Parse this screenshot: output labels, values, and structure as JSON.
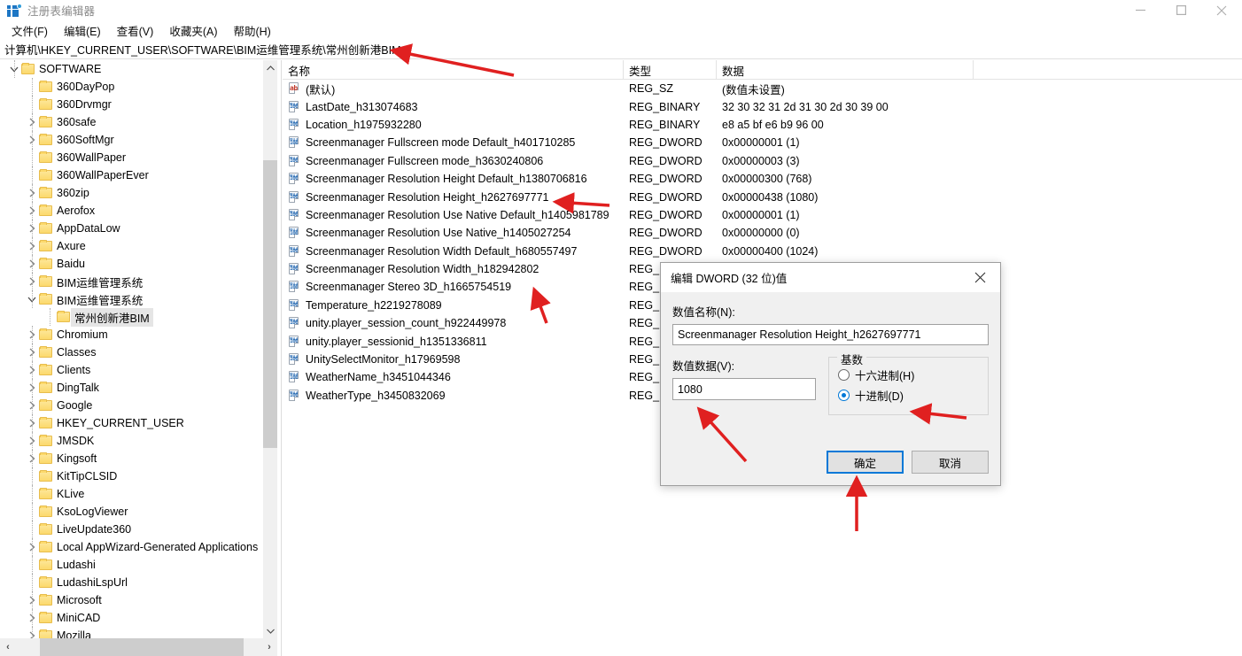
{
  "window": {
    "title": "注册表编辑器",
    "icon": "registry-editor-icon",
    "minimize": "–",
    "maximize": "□",
    "close": "✕"
  },
  "menu": [
    {
      "label": "文件(F)"
    },
    {
      "label": "编辑(E)"
    },
    {
      "label": "查看(V)"
    },
    {
      "label": "收藏夹(A)"
    },
    {
      "label": "帮助(H)"
    }
  ],
  "address": {
    "path": "计算机\\HKEY_CURRENT_USER\\SOFTWARE\\BIM运维管理系统\\常州创新港BIM"
  },
  "tree": {
    "items": [
      {
        "label": "SOFTWARE",
        "indent": 0,
        "expander": "open",
        "selected": false
      },
      {
        "label": "360DayPop",
        "indent": 1,
        "expander": "none",
        "selected": false
      },
      {
        "label": "360Drvmgr",
        "indent": 1,
        "expander": "none",
        "selected": false
      },
      {
        "label": "360safe",
        "indent": 1,
        "expander": "closed",
        "selected": false
      },
      {
        "label": "360SoftMgr",
        "indent": 1,
        "expander": "closed",
        "selected": false
      },
      {
        "label": "360WallPaper",
        "indent": 1,
        "expander": "none",
        "selected": false
      },
      {
        "label": "360WallPaperEver",
        "indent": 1,
        "expander": "none",
        "selected": false
      },
      {
        "label": "360zip",
        "indent": 1,
        "expander": "closed",
        "selected": false
      },
      {
        "label": "Aerofox",
        "indent": 1,
        "expander": "closed",
        "selected": false
      },
      {
        "label": "AppDataLow",
        "indent": 1,
        "expander": "closed",
        "selected": false
      },
      {
        "label": "Axure",
        "indent": 1,
        "expander": "closed",
        "selected": false
      },
      {
        "label": "Baidu",
        "indent": 1,
        "expander": "closed",
        "selected": false
      },
      {
        "label": "BIM运维管理系统",
        "indent": 1,
        "expander": "closed",
        "selected": false
      },
      {
        "label": "BIM运维管理系统",
        "indent": 1,
        "expander": "open",
        "selected": false
      },
      {
        "label": "常州创新港BIM",
        "indent": 2,
        "expander": "none",
        "selected": true
      },
      {
        "label": "Chromium",
        "indent": 1,
        "expander": "closed",
        "selected": false
      },
      {
        "label": "Classes",
        "indent": 1,
        "expander": "closed",
        "selected": false
      },
      {
        "label": "Clients",
        "indent": 1,
        "expander": "closed",
        "selected": false
      },
      {
        "label": "DingTalk",
        "indent": 1,
        "expander": "closed",
        "selected": false
      },
      {
        "label": "Google",
        "indent": 1,
        "expander": "closed",
        "selected": false
      },
      {
        "label": "HKEY_CURRENT_USER",
        "indent": 1,
        "expander": "closed",
        "selected": false
      },
      {
        "label": "JMSDK",
        "indent": 1,
        "expander": "closed",
        "selected": false
      },
      {
        "label": "Kingsoft",
        "indent": 1,
        "expander": "closed",
        "selected": false
      },
      {
        "label": "KitTipCLSID",
        "indent": 1,
        "expander": "none",
        "selected": false
      },
      {
        "label": "KLive",
        "indent": 1,
        "expander": "none",
        "selected": false
      },
      {
        "label": "KsoLogViewer",
        "indent": 1,
        "expander": "none",
        "selected": false
      },
      {
        "label": "LiveUpdate360",
        "indent": 1,
        "expander": "none",
        "selected": false
      },
      {
        "label": "Local AppWizard-Generated Applications",
        "indent": 1,
        "expander": "closed",
        "selected": false
      },
      {
        "label": "Ludashi",
        "indent": 1,
        "expander": "none",
        "selected": false
      },
      {
        "label": "LudashiLspUrl",
        "indent": 1,
        "expander": "none",
        "selected": false
      },
      {
        "label": "Microsoft",
        "indent": 1,
        "expander": "closed",
        "selected": false
      },
      {
        "label": "MiniCAD",
        "indent": 1,
        "expander": "closed",
        "selected": false
      },
      {
        "label": "Mozilla",
        "indent": 1,
        "expander": "closed",
        "selected": false
      }
    ]
  },
  "list": {
    "columns": [
      {
        "label": "名称"
      },
      {
        "label": "类型"
      },
      {
        "label": "数据"
      }
    ],
    "rows": [
      {
        "name": "(默认)",
        "type": "REG_SZ",
        "data": "(数值未设置)",
        "icon": "string-value-icon"
      },
      {
        "name": "LastDate_h313074683",
        "type": "REG_BINARY",
        "data": "32 30 32 31 2d 31 30 2d 30 39 00",
        "icon": "binary-value-icon"
      },
      {
        "name": "Location_h1975932280",
        "type": "REG_BINARY",
        "data": "e8 a5 bf e6 b9 96 00",
        "icon": "binary-value-icon"
      },
      {
        "name": "Screenmanager Fullscreen mode Default_h401710285",
        "type": "REG_DWORD",
        "data": "0x00000001 (1)",
        "icon": "binary-value-icon"
      },
      {
        "name": "Screenmanager Fullscreen mode_h3630240806",
        "type": "REG_DWORD",
        "data": "0x00000003 (3)",
        "icon": "binary-value-icon"
      },
      {
        "name": "Screenmanager Resolution Height Default_h1380706816",
        "type": "REG_DWORD",
        "data": "0x00000300 (768)",
        "icon": "binary-value-icon"
      },
      {
        "name": "Screenmanager Resolution Height_h2627697771",
        "type": "REG_DWORD",
        "data": "0x00000438 (1080)",
        "icon": "binary-value-icon"
      },
      {
        "name": "Screenmanager Resolution Use Native Default_h1405981789",
        "type": "REG_DWORD",
        "data": "0x00000001 (1)",
        "icon": "binary-value-icon"
      },
      {
        "name": "Screenmanager Resolution Use Native_h1405027254",
        "type": "REG_DWORD",
        "data": "0x00000000 (0)",
        "icon": "binary-value-icon"
      },
      {
        "name": "Screenmanager Resolution Width Default_h680557497",
        "type": "REG_DWORD",
        "data": "0x00000400 (1024)",
        "icon": "binary-value-icon"
      },
      {
        "name": "Screenmanager Resolution Width_h182942802",
        "type": "REG_D",
        "data": "",
        "icon": "binary-value-icon"
      },
      {
        "name": "Screenmanager Stereo 3D_h1665754519",
        "type": "REG_D",
        "data": "",
        "icon": "binary-value-icon"
      },
      {
        "name": "Temperature_h2219278089",
        "type": "REG_B",
        "data": "",
        "icon": "binary-value-icon"
      },
      {
        "name": "unity.player_session_count_h922449978",
        "type": "REG_B",
        "data": "",
        "icon": "binary-value-icon"
      },
      {
        "name": "unity.player_sessionid_h1351336811",
        "type": "REG_B",
        "data": "",
        "icon": "binary-value-icon"
      },
      {
        "name": "UnitySelectMonitor_h17969598",
        "type": "REG_D",
        "data": "",
        "icon": "binary-value-icon"
      },
      {
        "name": "WeatherName_h3451044346",
        "type": "REG_B",
        "data": "",
        "icon": "binary-value-icon"
      },
      {
        "name": "WeatherType_h3450832069",
        "type": "REG_B",
        "data": "",
        "icon": "binary-value-icon"
      }
    ]
  },
  "dialog": {
    "title": "编辑 DWORD (32 位)值",
    "close_label": "✕",
    "name_label": "数值名称(N):",
    "name_value": "Screenmanager Resolution Height_h2627697771",
    "data_label": "数值数据(V):",
    "data_value": "1080",
    "base_group_label": "基数",
    "radios": [
      {
        "label": "十六进制(H)",
        "checked": false
      },
      {
        "label": "十进制(D)",
        "checked": true
      }
    ],
    "ok_label": "确定",
    "cancel_label": "取消"
  },
  "annotations": {
    "color": "#e02020",
    "arrows": [
      {
        "name": "address-path-arrow"
      },
      {
        "name": "height-value-row-arrow"
      },
      {
        "name": "width-value-row-arrow"
      },
      {
        "name": "data-input-arrow"
      },
      {
        "name": "decimal-radio-arrow"
      },
      {
        "name": "ok-button-arrow"
      }
    ]
  }
}
